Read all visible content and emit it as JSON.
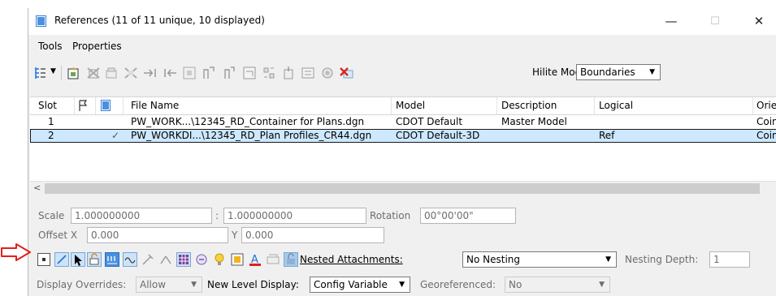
{
  "window": {
    "title": "References (11 of 11 unique, 10 displayed)",
    "minimize": "—",
    "maximize": "☐",
    "close": "✕"
  },
  "menu": [
    {
      "label": "Tools"
    },
    {
      "label": "Properties"
    }
  ],
  "toolbar": {
    "hilite_label": "Hilite Mode:",
    "hilite_value": "Boundaries"
  },
  "table": {
    "columns": [
      "Slot",
      "",
      "",
      "File Name",
      "Model",
      "Description",
      "Logical",
      "Orien"
    ],
    "rows": [
      {
        "slot": "1",
        "check": "",
        "file": "PW_WORK...\\12345_RD_Container for Plans.dgn",
        "model": "CDOT Default",
        "description": "Master Model",
        "logical": "",
        "orientation": "Coin"
      },
      {
        "slot": "2",
        "check": "✓",
        "file": "PW_WORKDI...\\12345_RD_Plan Profiles_CR44.dgn",
        "model": "CDOT Default-3D",
        "description": "",
        "logical": "Ref",
        "orientation": "Coin"
      }
    ]
  },
  "properties": {
    "scale_label": "Scale",
    "scale_x": "1.000000000",
    "scale_sep": ":",
    "scale_y": "1.000000000",
    "rotation_label": "Rotation",
    "rotation": "00°00'00\"",
    "offset_x_label": "Offset X",
    "offset_x": "0.000",
    "offset_y_label": "Y",
    "offset_y": "0.000"
  },
  "attach": {
    "nested_label": "Nested Attachments:",
    "nested_value": "No Nesting",
    "depth_label": "Nesting Depth:",
    "depth_value": "1",
    "display_overrides_label": "Display Overrides:",
    "display_overrides_value": "Allow",
    "new_level_label": "New Level Display:",
    "new_level_value": "Config Variable",
    "georef_label": "Georeferenced:",
    "georef_value": "No"
  },
  "colors": {
    "arrow": "#e0201b",
    "accent_blue": "#1e6fd9",
    "selection": "#cde8ff"
  },
  "icons": [
    "list-view-icon",
    "attach-reference-icon",
    "detach-icon",
    "reload-icon",
    "exchange-icon",
    "move-icon",
    "copy-icon",
    "rotate-icon",
    "mirror-h-icon",
    "mirror-v-icon",
    "clip-boundary-icon",
    "clip-mask-icon",
    "clip-front-icon",
    "clip-back-icon",
    "settings-icon",
    "clip-delete-icon"
  ]
}
